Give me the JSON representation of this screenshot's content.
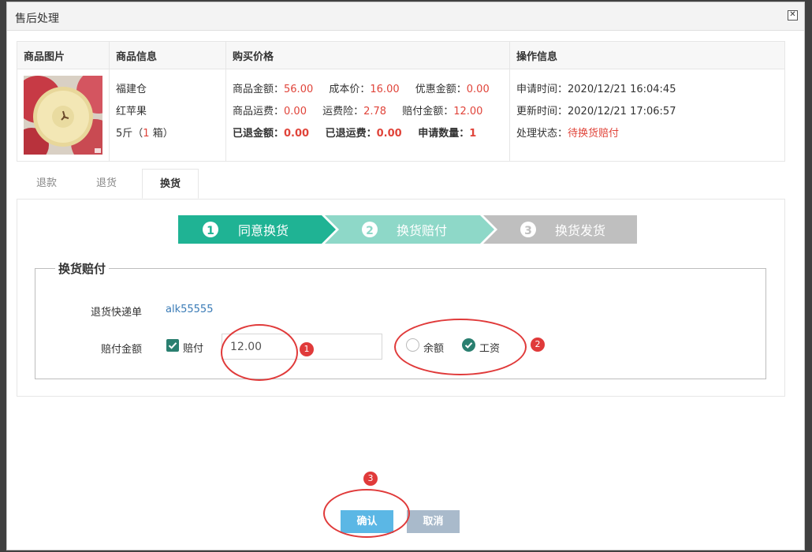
{
  "dialog": {
    "title": "售后处理",
    "close_glyph": "✕"
  },
  "table": {
    "headers": [
      "商品图片",
      "商品信息",
      "购买价格",
      "操作信息"
    ],
    "product": {
      "image_alt": "apple-photo",
      "warehouse": "福建仓",
      "name": "红苹果",
      "spec_prefix": "5斤（",
      "spec_qty": "1",
      "spec_suffix": " 箱）"
    },
    "price": {
      "row1": [
        {
          "label": "商品金额：",
          "value": "56.00"
        },
        {
          "label": "成本价：",
          "value": "16.00"
        },
        {
          "label": "优惠金额：",
          "value": "0.00"
        }
      ],
      "row2": [
        {
          "label": "商品运费：",
          "value": "0.00"
        },
        {
          "label": "运费险：",
          "value": "2.78"
        },
        {
          "label": "赔付金额：",
          "value": "12.00"
        }
      ],
      "row3": [
        {
          "label": "已退金额：",
          "value": "0.00"
        },
        {
          "label": "已退运费：",
          "value": "0.00"
        },
        {
          "label": "申请数量：",
          "value": "1"
        }
      ]
    },
    "ops": {
      "apply_label": "申请时间：",
      "apply_time": "2020/12/21 16:04:45",
      "update_label": "更新时间：",
      "update_time": "2020/12/21 17:06:57",
      "status_label": "处理状态：",
      "status_value": "待换货赔付"
    }
  },
  "tabs": [
    "退款",
    "退货",
    "换货"
  ],
  "active_tab": 2,
  "steps": [
    {
      "num": "1",
      "label": "同意换货"
    },
    {
      "num": "2",
      "label": "换货赔付"
    },
    {
      "num": "3",
      "label": "换货发货"
    }
  ],
  "form": {
    "legend": "换货赔付",
    "tracking_label": "退货快递单",
    "tracking_value": "alk55555",
    "amount_label": "赔付金额",
    "compensate_label": "赔付",
    "amount_value": "12.00",
    "radio_balance": "余额",
    "radio_salary": "工资"
  },
  "annotations": [
    "1",
    "2",
    "3"
  ],
  "buttons": {
    "confirm": "确认",
    "cancel": "取消"
  },
  "colors": {
    "step_active": "#1fb394",
    "step_current": "#8ed8c8",
    "step_pending": "#bfbfbf",
    "accent_red": "#e0443a",
    "check_green": "#2a7f70"
  }
}
